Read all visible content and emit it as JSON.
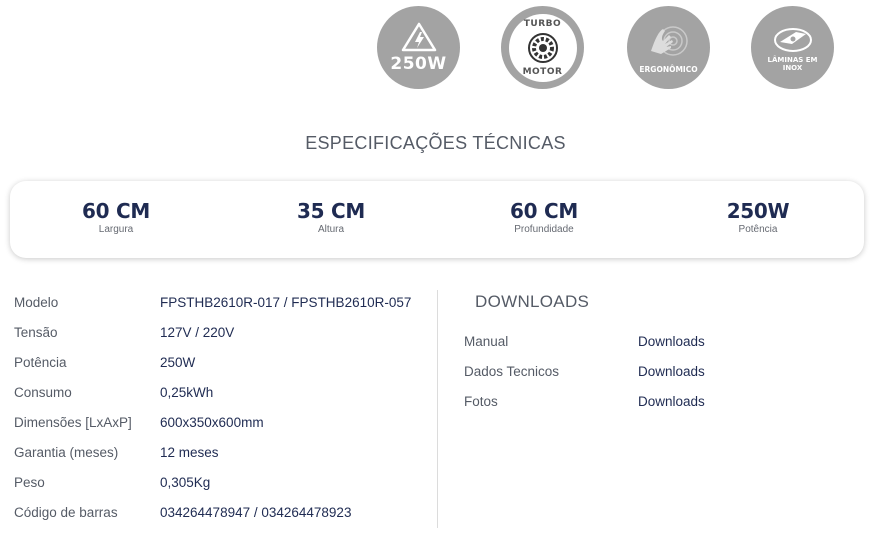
{
  "badges": [
    {
      "icon": "lightning-triangle-icon",
      "label": "250W"
    },
    {
      "icon": "turbo-motor-icon",
      "top": "TURBO",
      "bottom": "MOTOR"
    },
    {
      "icon": "hand-grip-icon",
      "label": "ERGONÔMICO"
    },
    {
      "icon": "blade-icon",
      "label": "LÂMINAS EM INOX"
    }
  ],
  "specs_title": "ESPECIFICAÇÕES TÉCNICAS",
  "highlights": [
    {
      "value": "60 CM",
      "caption": "Largura"
    },
    {
      "value": "35 CM",
      "caption": "Altura"
    },
    {
      "value": "60 CM",
      "caption": "Profundidade"
    },
    {
      "value": "250W",
      "caption": "Potência"
    }
  ],
  "technical": [
    {
      "key": "Modelo",
      "value": "FPSTHB2610R-017 / FPSTHB2610R-057"
    },
    {
      "key": "Tensão",
      "value": "127V / 220V"
    },
    {
      "key": "Potência",
      "value": "250W"
    },
    {
      "key": "Consumo",
      "value": "0,25kWh"
    },
    {
      "key": "Dimensões [LxAxP]",
      "value": "600x350x600mm"
    },
    {
      "key": "Garantia (meses)",
      "value": "12 meses"
    },
    {
      "key": "Peso",
      "value": "0,305Kg"
    },
    {
      "key": "Código de barras",
      "value": "034264478947 / 034264478923"
    }
  ],
  "downloads": {
    "title": "DOWNLOADS",
    "items": [
      {
        "key": "Manual",
        "link": "Downloads"
      },
      {
        "key": "Dados Tecnicos",
        "link": "Downloads"
      },
      {
        "key": "Fotos",
        "link": "Downloads"
      }
    ]
  },
  "colors": {
    "badge_bg": "#a3a3a3",
    "navy": "#1f2b52",
    "gray_text": "#555b66"
  }
}
